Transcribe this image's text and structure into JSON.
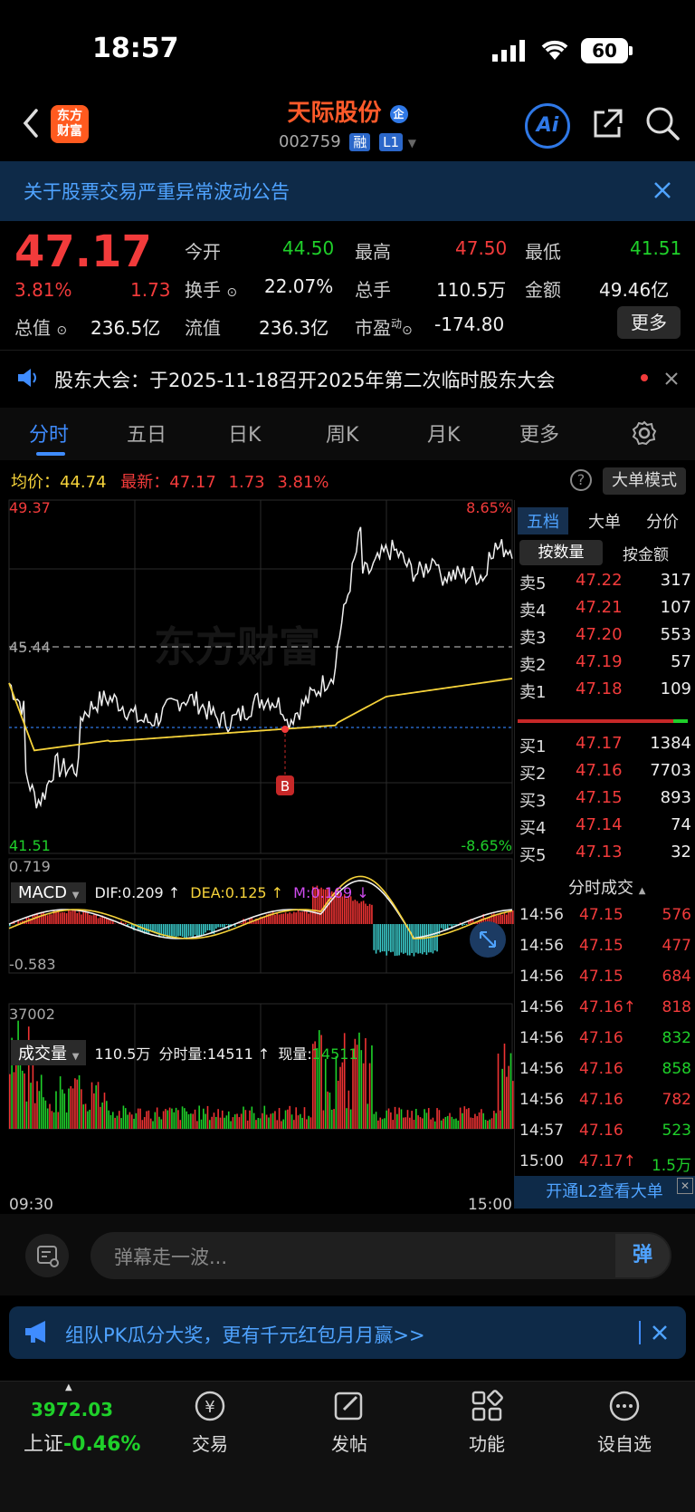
{
  "status_bar": {
    "time": "18:57",
    "battery": "60"
  },
  "nav": {
    "logo_line1": "东方",
    "logo_line2": "财富",
    "stock_name": "天际股份",
    "stock_badge": "企",
    "stock_code": "002759",
    "tag_margin": "融",
    "tag_level": "L1",
    "ai_label": "Ai"
  },
  "notice": {
    "text": "关于股票交易严重异常波动公告"
  },
  "quote": {
    "price": "47.17",
    "change_pct": "3.81%",
    "change": "1.73",
    "open_label": "今开",
    "open": "44.50",
    "high_label": "最高",
    "high": "47.50",
    "low_label": "最低",
    "low": "41.51",
    "turnover_label": "换手",
    "turnover": "22.07%",
    "volume_label": "总手",
    "volume": "110.5万",
    "amount_label": "金额",
    "amount": "49.46亿",
    "mktcap_label": "总值",
    "mktcap": "236.5亿",
    "float_label": "流值",
    "float_cap": "236.3亿",
    "pe_label": "市盈",
    "pe_sup": "动",
    "pe": "-174.80",
    "more_label": "更多"
  },
  "announcement": {
    "text": "股东大会：于2025-11-18召开2025年第二次临时股东大会"
  },
  "tabs": [
    "分时",
    "五日",
    "日K",
    "周K",
    "月K",
    "更多"
  ],
  "info_row": {
    "avg_label": "均价：",
    "avg": "44.74",
    "latest_label": "最新：",
    "latest": "47.17",
    "chg": "1.73",
    "chg_pct": "3.81%",
    "bigorder_label": "大单模式"
  },
  "chart_data": {
    "type": "line",
    "price_axis": {
      "top": "49.37",
      "bottom": "41.51",
      "top_pct": "8.65%",
      "bottom_pct": "-8.65%",
      "prev_close": "45.44",
      "ylim": [
        41.51,
        49.37
      ]
    },
    "x_labels": {
      "start": "09:30",
      "end": "15:00"
    },
    "marker": "B",
    "watermark": "东方财富",
    "macd": {
      "label": "MACD",
      "dif_label": "DIF:",
      "dif": "0.209 ↑",
      "dea_label": "DEA:",
      "dea": "0.125 ↑",
      "m_label": "M:",
      "m": "0.169 ↓",
      "top": "0.719",
      "bottom": "-0.583"
    },
    "volume": {
      "label": "成交量",
      "total": "110.5万",
      "period_label": "分时量:",
      "period": "14511 ↑",
      "now_label": "现量:",
      "now": "14511",
      "max": "37002"
    }
  },
  "right_panel": {
    "tabs": [
      "五档",
      "大单",
      "分价"
    ],
    "sub_tabs": [
      "按数量",
      "按金额"
    ],
    "asks": [
      {
        "label": "卖5",
        "price": "47.22",
        "vol": "317"
      },
      {
        "label": "卖4",
        "price": "47.21",
        "vol": "107"
      },
      {
        "label": "卖3",
        "price": "47.20",
        "vol": "553"
      },
      {
        "label": "卖2",
        "price": "47.19",
        "vol": "57"
      },
      {
        "label": "卖1",
        "price": "47.18",
        "vol": "109"
      }
    ],
    "bids": [
      {
        "label": "买1",
        "price": "47.17",
        "vol": "1384"
      },
      {
        "label": "买2",
        "price": "47.16",
        "vol": "7703"
      },
      {
        "label": "买3",
        "price": "47.15",
        "vol": "893"
      },
      {
        "label": "买4",
        "price": "47.14",
        "vol": "74"
      },
      {
        "label": "买5",
        "price": "47.13",
        "vol": "32"
      }
    ],
    "trades_title": "分时成交",
    "trades": [
      {
        "time": "14:56",
        "price": "47.15",
        "vol": "576",
        "color": "red"
      },
      {
        "time": "14:56",
        "price": "47.15",
        "vol": "477",
        "color": "red"
      },
      {
        "time": "14:56",
        "price": "47.15",
        "vol": "684",
        "color": "red"
      },
      {
        "time": "14:56",
        "price": "47.16↑",
        "vol": "818",
        "color": "red"
      },
      {
        "time": "14:56",
        "price": "47.16",
        "vol": "832",
        "color": "green"
      },
      {
        "time": "14:56",
        "price": "47.16",
        "vol": "858",
        "color": "green"
      },
      {
        "time": "14:56",
        "price": "47.16",
        "vol": "782",
        "color": "red"
      },
      {
        "time": "14:57",
        "price": "47.16",
        "vol": "523",
        "color": "green"
      },
      {
        "time": "15:00",
        "price": "47.17↑",
        "vol": "1.5万",
        "color": "green"
      }
    ],
    "l2_banner": "开通L2查看大单"
  },
  "danmu": {
    "placeholder": "弹幕走一波...",
    "send": "弹"
  },
  "promo": {
    "text": "组队PK瓜分大奖，更有千元红包月月赢>>"
  },
  "tabbar": {
    "index_value": "3972.03",
    "index_name": "上证",
    "index_chg": "-0.46%",
    "items": [
      "交易",
      "发帖",
      "功能",
      "设自选"
    ]
  },
  "colors": {
    "up": "#f23b3b",
    "down": "#1fd02a",
    "accent": "#3f8cff",
    "avg_line": "#f5d23a"
  }
}
